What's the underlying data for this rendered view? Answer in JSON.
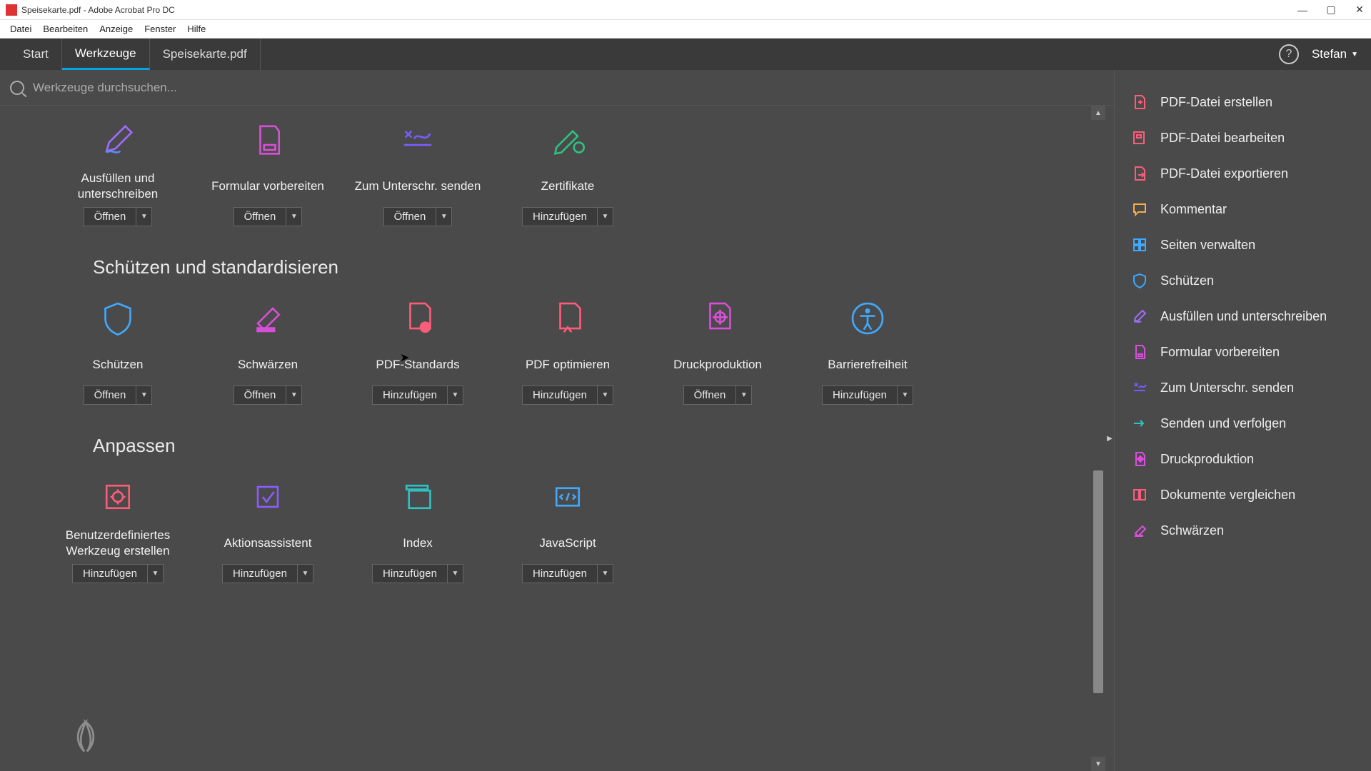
{
  "window": {
    "title": "Speisekarte.pdf - Adobe Acrobat Pro DC"
  },
  "menu": {
    "items": [
      "Datei",
      "Bearbeiten",
      "Anzeige",
      "Fenster",
      "Hilfe"
    ]
  },
  "tabs": {
    "start": "Start",
    "tools": "Werkzeuge",
    "doc": "Speisekarte.pdf",
    "user": "Stefan"
  },
  "search": {
    "placeholder": "Werkzeuge durchsuchen..."
  },
  "sections": {
    "forms_row": [
      {
        "label": "Ausfüllen und unterschreiben",
        "action": "Öffnen"
      },
      {
        "label": "Formular vorbereiten",
        "action": "Öffnen"
      },
      {
        "label": "Zum Unterschr. senden",
        "action": "Öffnen"
      },
      {
        "label": "Zertifikate",
        "action": "Hinzufügen"
      }
    ],
    "protect_title": "Schützen und standardisieren",
    "protect_row": [
      {
        "label": "Schützen",
        "action": "Öffnen"
      },
      {
        "label": "Schwärzen",
        "action": "Öffnen"
      },
      {
        "label": "PDF-Standards",
        "action": "Hinzufügen"
      },
      {
        "label": "PDF optimieren",
        "action": "Hinzufügen"
      },
      {
        "label": "Druckproduktion",
        "action": "Öffnen"
      },
      {
        "label": "Barrierefreiheit",
        "action": "Hinzufügen"
      }
    ],
    "customize_title": "Anpassen",
    "customize_row": [
      {
        "label": "Benutzerdefiniertes Werkzeug erstellen",
        "action": "Hinzufügen"
      },
      {
        "label": "Aktionsassistent",
        "action": "Hinzufügen"
      },
      {
        "label": "Index",
        "action": "Hinzufügen"
      },
      {
        "label": "JavaScript",
        "action": "Hinzufügen"
      }
    ]
  },
  "rightbar": [
    "PDF-Datei erstellen",
    "PDF-Datei bearbeiten",
    "PDF-Datei exportieren",
    "Kommentar",
    "Seiten verwalten",
    "Schützen",
    "Ausfüllen und unterschreiben",
    "Formular vorbereiten",
    "Zum Unterschr. senden",
    "Senden und verfolgen",
    "Druckproduktion",
    "Dokumente vergleichen",
    "Schwärzen"
  ]
}
